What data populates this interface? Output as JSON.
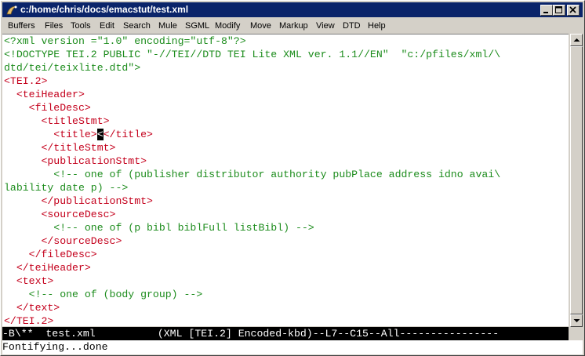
{
  "window": {
    "title": "c:/home/chris/docs/emacstut/test.xml",
    "controls": [
      "minimize",
      "maximize",
      "close"
    ]
  },
  "menu": [
    "Buffers",
    "Files",
    "Tools",
    "Edit",
    "Search",
    "Mule",
    "SGML",
    "Modify",
    "Move",
    "Markup",
    "View",
    "DTD",
    "Help"
  ],
  "editor": {
    "lines": [
      "<?xml version =\"1.0\" encoding=\"utf-8\"?>",
      "<!DOCTYPE TEI.2 PUBLIC \"-//TEI//DTD TEI Lite XML ver. 1.1//EN\"  \"c:/pfiles/xml/\\",
      "dtd/tei/teixlite.dtd\">",
      "<TEI.2>",
      "  <teiHeader>",
      "    <fileDesc>",
      "      <titleStmt>",
      "        <title>",
      "</title>",
      "      </titleStmt>",
      "      <publicationStmt>",
      "        <!-- one of (publisher distributor authority pubPlace address idno avai\\",
      "lability date p) -->",
      "      </publicationStmt>",
      "      <sourceDesc>",
      "        <!-- one of (p bibl biblFull listBibl) -->",
      "      </sourceDesc>",
      "    </fileDesc>",
      "  </teiHeader>",
      "  <text>",
      "    <!-- one of (body group) -->",
      "  </text>",
      "</TEI.2>"
    ],
    "cursor_char": "<"
  },
  "modeline": "-B\\**  test.xml          (XML [TEI.2] Encoded-kbd)--L7--C15--All----------------",
  "echo_area": "Fontifying...done",
  "colors": {
    "tag": "#c4001c",
    "declaration": "#1c8c1c",
    "titlebar": "#0a246a"
  }
}
